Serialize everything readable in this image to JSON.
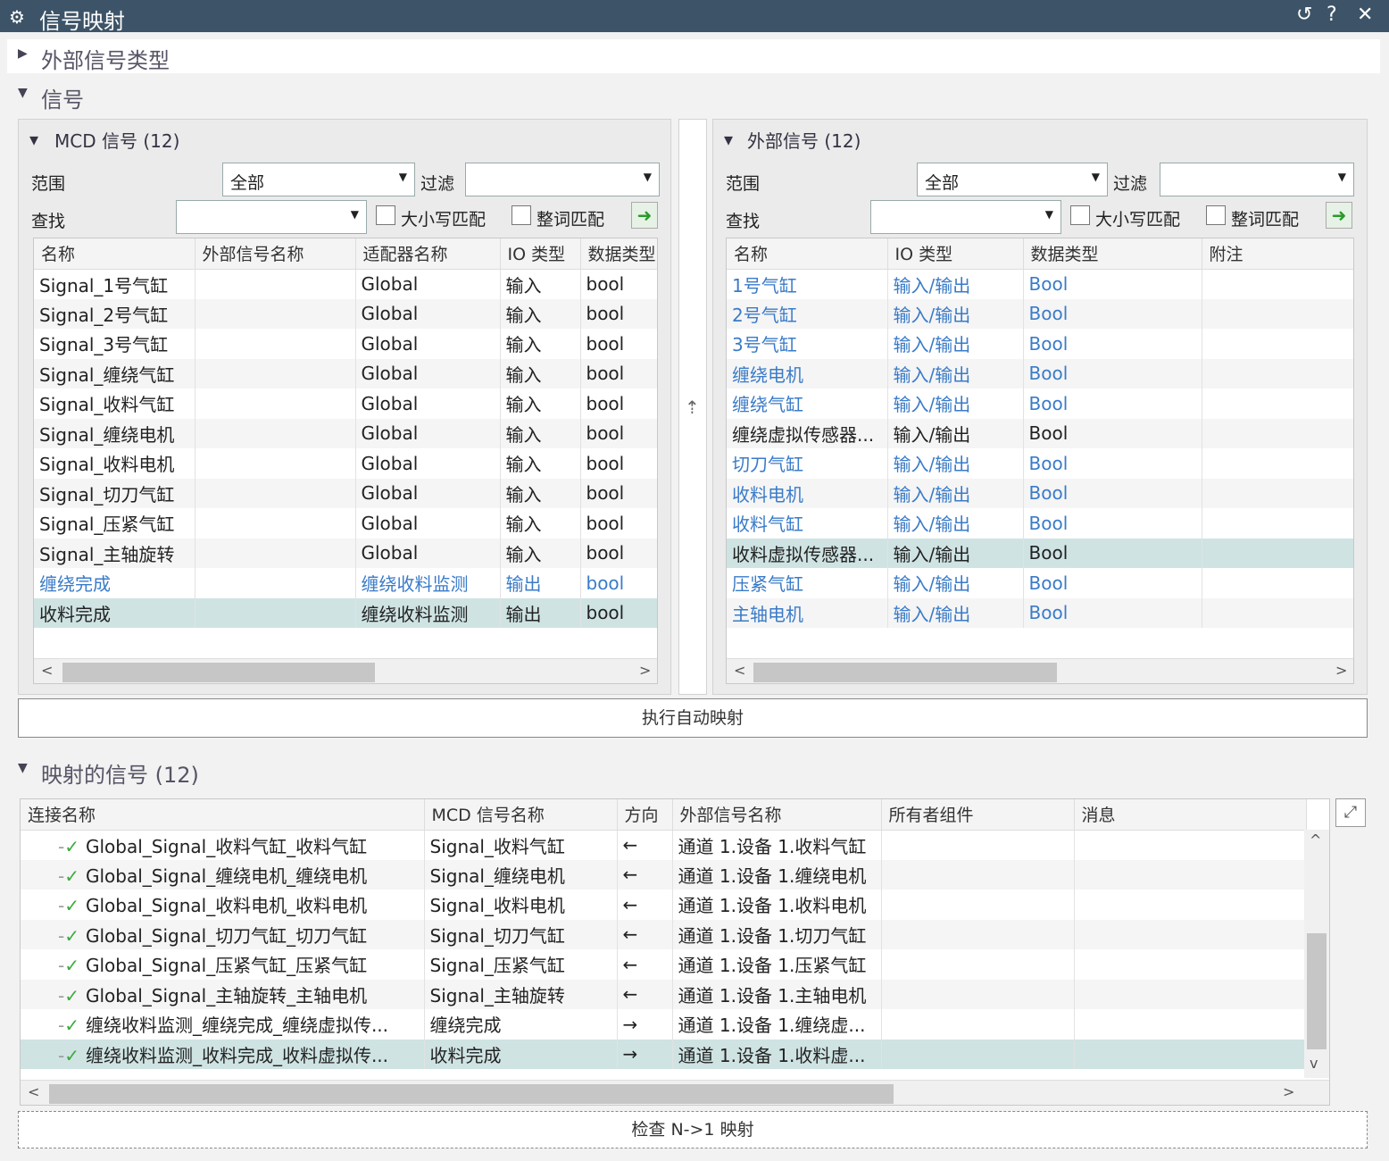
{
  "window": {
    "title": "信号映射",
    "icon": "gear-icon",
    "buttons": [
      "↺",
      "?",
      "✕"
    ]
  },
  "sections": {
    "external_types": "外部信号类型",
    "signals": "信号",
    "mapped": "映射的信号 (12)"
  },
  "mcd": {
    "title": "MCD 信号 (12)",
    "scope_label": "范围",
    "scope_value": "全部",
    "filter_label": "过滤",
    "find_label": "查找",
    "case_label": "大小写匹配",
    "word_label": "整词匹配",
    "columns": [
      "名称",
      "外部信号名称",
      "适配器名称",
      "IO 类型",
      "数据类型"
    ],
    "rows": [
      [
        "Signal_1号气缸",
        "",
        "Global",
        "输入",
        "bool"
      ],
      [
        "Signal_2号气缸",
        "",
        "Global",
        "输入",
        "bool"
      ],
      [
        "Signal_3号气缸",
        "",
        "Global",
        "输入",
        "bool"
      ],
      [
        "Signal_缠绕气缸",
        "",
        "Global",
        "输入",
        "bool"
      ],
      [
        "Signal_收料气缸",
        "",
        "Global",
        "输入",
        "bool"
      ],
      [
        "Signal_缠绕电机",
        "",
        "Global",
        "输入",
        "bool"
      ],
      [
        "Signal_收料电机",
        "",
        "Global",
        "输入",
        "bool"
      ],
      [
        "Signal_切刀气缸",
        "",
        "Global",
        "输入",
        "bool"
      ],
      [
        "Signal_压紧气缸",
        "",
        "Global",
        "输入",
        "bool"
      ],
      [
        "Signal_主轴旋转",
        "",
        "Global",
        "输入",
        "bool"
      ],
      [
        "缠绕完成",
        "",
        "缠绕收料监测",
        "输出",
        "bool"
      ],
      [
        "收料完成",
        "",
        "缠绕收料监测",
        "输出",
        "bool"
      ]
    ]
  },
  "ext": {
    "title": "外部信号 (12)",
    "scope_label": "范围",
    "scope_value": "全部",
    "filter_label": "过滤",
    "find_label": "查找",
    "case_label": "大小写匹配",
    "word_label": "整词匹配",
    "columns": [
      "名称",
      "IO 类型",
      "数据类型",
      "附注"
    ],
    "rows": [
      [
        "1号气缸",
        "输入/输出",
        "Bool",
        ""
      ],
      [
        "2号气缸",
        "输入/输出",
        "Bool",
        ""
      ],
      [
        "3号气缸",
        "输入/输出",
        "Bool",
        ""
      ],
      [
        "缠绕电机",
        "输入/输出",
        "Bool",
        ""
      ],
      [
        "缠绕气缸",
        "输入/输出",
        "Bool",
        ""
      ],
      [
        "缠绕虚拟传感器...",
        "输入/输出",
        "Bool",
        ""
      ],
      [
        "切刀气缸",
        "输入/输出",
        "Bool",
        ""
      ],
      [
        "收料电机",
        "输入/输出",
        "Bool",
        ""
      ],
      [
        "收料气缸",
        "输入/输出",
        "Bool",
        ""
      ],
      [
        "收料虚拟传感器...",
        "输入/输出",
        "Bool",
        ""
      ],
      [
        "压紧气缸",
        "输入/输出",
        "Bool",
        ""
      ],
      [
        "主轴电机",
        "输入/输出",
        "Bool",
        ""
      ]
    ]
  },
  "auto_map_button": "执行自动映射",
  "mapped": {
    "columns": [
      "连接名称",
      "MCD 信号名称",
      "方向",
      "外部信号名称",
      "所有者组件",
      "消息"
    ],
    "rows": [
      [
        "Global_Signal_收料气缸_收料气缸",
        "Signal_收料气缸",
        "←",
        "通道 1.设备 1.收料气缸",
        "",
        ""
      ],
      [
        "Global_Signal_缠绕电机_缠绕电机",
        "Signal_缠绕电机",
        "←",
        "通道 1.设备 1.缠绕电机",
        "",
        ""
      ],
      [
        "Global_Signal_收料电机_收料电机",
        "Signal_收料电机",
        "←",
        "通道 1.设备 1.收料电机",
        "",
        ""
      ],
      [
        "Global_Signal_切刀气缸_切刀气缸",
        "Signal_切刀气缸",
        "←",
        "通道 1.设备 1.切刀气缸",
        "",
        ""
      ],
      [
        "Global_Signal_压紧气缸_压紧气缸",
        "Signal_压紧气缸",
        "←",
        "通道 1.设备 1.压紧气缸",
        "",
        ""
      ],
      [
        "Global_Signal_主轴旋转_主轴电机",
        "Signal_主轴旋转",
        "←",
        "通道 1.设备 1.主轴电机",
        "",
        ""
      ],
      [
        "缠绕收料监测_缠绕完成_缠绕虚拟传...",
        "缠绕完成",
        "→",
        "通道 1.设备 1.缠绕虚...",
        "",
        ""
      ],
      [
        "缠绕收料监测_收料完成_收料虚拟传...",
        "收料完成",
        "→",
        "通道 1.设备 1.收料虚...",
        "",
        ""
      ]
    ]
  },
  "check_button": "检查 N->1 映射",
  "colors": {
    "titlebar": "#3d5468",
    "selected_row": "#cfe3e3",
    "link_blue": "#3a7bc8",
    "check_green": "#3aaa3a"
  }
}
